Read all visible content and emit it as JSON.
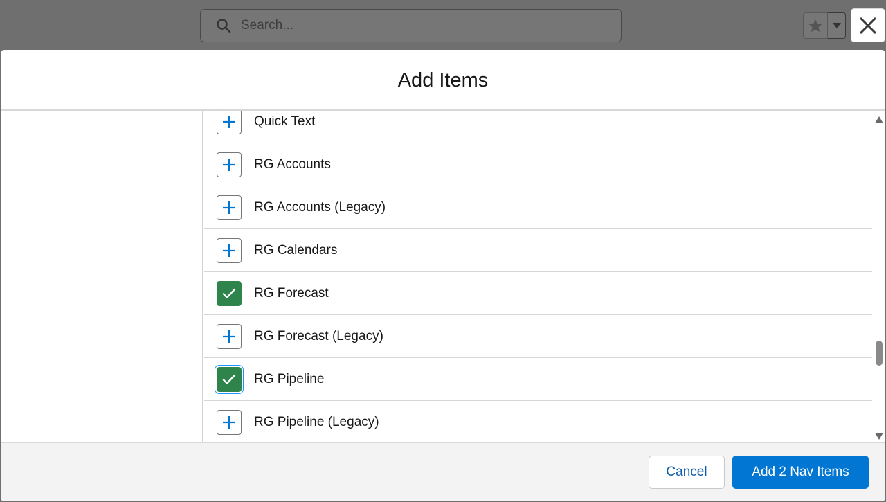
{
  "background": {
    "search": {
      "placeholder": "Search...",
      "icon": "search-icon"
    },
    "favorites": {
      "star_icon": "star-icon",
      "caret_icon": "caret-down-icon"
    }
  },
  "modal": {
    "title": "Add Items",
    "close_icon": "close-icon",
    "items": [
      {
        "label": "Quick Text",
        "state": "add"
      },
      {
        "label": "RG Accounts",
        "state": "add"
      },
      {
        "label": "RG Accounts (Legacy)",
        "state": "add"
      },
      {
        "label": "RG Calendars",
        "state": "add"
      },
      {
        "label": "RG Forecast",
        "state": "selected"
      },
      {
        "label": "RG Forecast (Legacy)",
        "state": "add"
      },
      {
        "label": "RG Pipeline",
        "state": "selected"
      },
      {
        "label": "RG Pipeline (Legacy)",
        "state": "add"
      }
    ],
    "footer": {
      "cancel_label": "Cancel",
      "primary_label": "Add 2 Nav Items"
    }
  },
  "colors": {
    "brand": "#0176d3",
    "selected": "#2e844a",
    "overlay": "#6f6f6f"
  }
}
